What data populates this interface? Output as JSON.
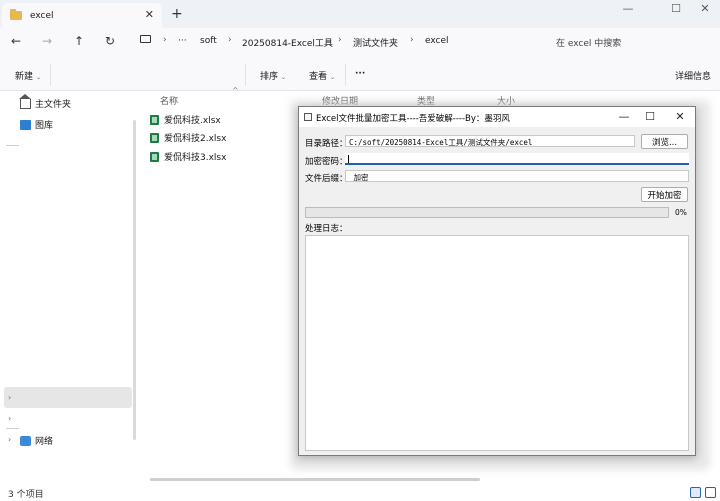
{
  "tab": {
    "title": "excel"
  },
  "breadcrumbs": [
    "soft",
    "20250814-Excel工具",
    "测试文件夹",
    "excel"
  ],
  "search": {
    "placeholder": "在 excel 中搜索"
  },
  "toolbar": {
    "new_label": "新建",
    "sort_label": "排序",
    "view_label": "查看",
    "more_label": "···",
    "details_label": "详细信息"
  },
  "sidebar": {
    "home_label": "主文件夹",
    "gallery_label": "图库",
    "network_label": "网络"
  },
  "columns": {
    "name": "名称",
    "modified": "修改日期",
    "type": "类型",
    "size": "大小"
  },
  "files": [
    "爱侃科技.xlsx",
    "爱侃科技2.xlsx",
    "爱侃科技3.xlsx"
  ],
  "status": {
    "count": "3 个项目"
  },
  "dialog": {
    "title": "Excel文件批量加密工具----吾爱破解----By：墨羽风",
    "path_label": "目录路径：",
    "path_value": "C:/soft/20250814-Excel工具/测试文件夹/excel",
    "browse_label": "浏览...",
    "password_label": "加密密码：",
    "password_value": "",
    "suffix_label": "文件后缀：",
    "suffix_value": "_加密",
    "start_label": "开始加密",
    "progress_percent": 0,
    "progress_text": "0%",
    "log_label": "处理日志："
  }
}
